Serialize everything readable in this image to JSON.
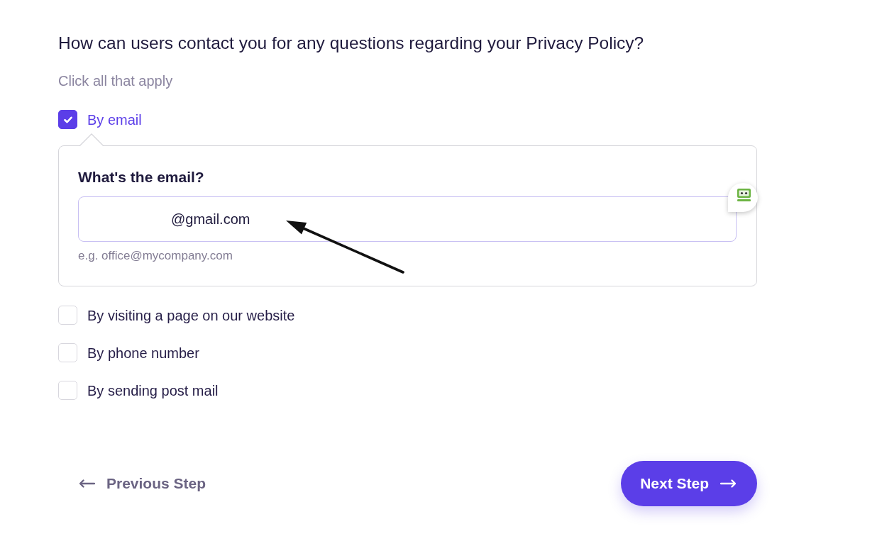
{
  "question": {
    "title": "How can users contact you for any questions regarding your Privacy Policy?",
    "hint": "Click all that apply"
  },
  "options": [
    {
      "label": "By email",
      "checked": true,
      "detail": {
        "title": "What's the email?",
        "value": "@gmail.com",
        "example": "e.g. office@mycompany.com"
      }
    },
    {
      "label": "By visiting a page on our website",
      "checked": false
    },
    {
      "label": "By phone number",
      "checked": false
    },
    {
      "label": "By sending post mail",
      "checked": false
    }
  ],
  "navigation": {
    "previous": "Previous Step",
    "next": "Next Step"
  }
}
